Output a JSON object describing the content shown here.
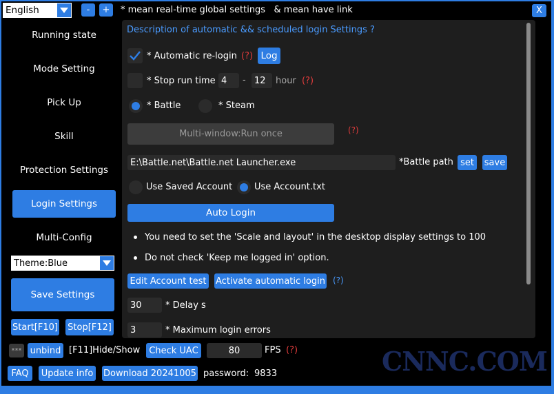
{
  "top": {
    "language": "English",
    "minus": "-",
    "plus": "+",
    "note": "* mean real-time global settings   & mean have link",
    "close": "X"
  },
  "sidebar": {
    "items": [
      {
        "label": "Running state"
      },
      {
        "label": "Mode Setting"
      },
      {
        "label": "Pick Up"
      },
      {
        "label": "Skill"
      },
      {
        "label": "Protection Settings"
      },
      {
        "label": "Login Settings"
      },
      {
        "label": "Multi-Config"
      }
    ],
    "theme": "Theme:Blue",
    "save": "Save Settings",
    "start": "Start[F10]",
    "stop": "Stop[F12]"
  },
  "panel": {
    "title": "Description of automatic && scheduled login Settings ?",
    "auto_relogin": "* Automatic re-login",
    "help": "(?)",
    "log": "Log",
    "stop_run_time": "* Stop run time",
    "stop_from": "4",
    "dash": "-",
    "stop_to": "12",
    "hour": "hour",
    "battle": "* Battle",
    "steam": "* Steam",
    "multi_window": "Multi-window:Run once",
    "path_value": "E:\\Battle.net\\Battle.net Launcher.exe",
    "path_label": "*Battle path",
    "set": "set",
    "save": "save",
    "use_saved": "Use Saved Account",
    "use_txt": "Use Account.txt",
    "auto_login": "Auto Login",
    "bullet1": "You need to set the 'Scale and layout' in the desktop display settings to 100",
    "bullet2": "Do not check 'Keep me logged in' option.",
    "edit_account": "Edit Account test",
    "activate": "Activate automatic login",
    "delay_value": "30",
    "delay_label": "* Delay s",
    "max_errors_value": "3",
    "max_errors_label": "* Maximum login errors"
  },
  "bottom": {
    "masked": "***",
    "unbind": "unbind",
    "hide_show": "[F11]Hide/Show",
    "check_uac": "Check UAC",
    "fps_value": "80",
    "fps": "FPS",
    "help": "(?)",
    "faq": "FAQ",
    "update": "Update info",
    "download": "Download 20241005",
    "password_label": "password:",
    "password_value": "9833"
  },
  "watermark": "CNNC.COM"
}
